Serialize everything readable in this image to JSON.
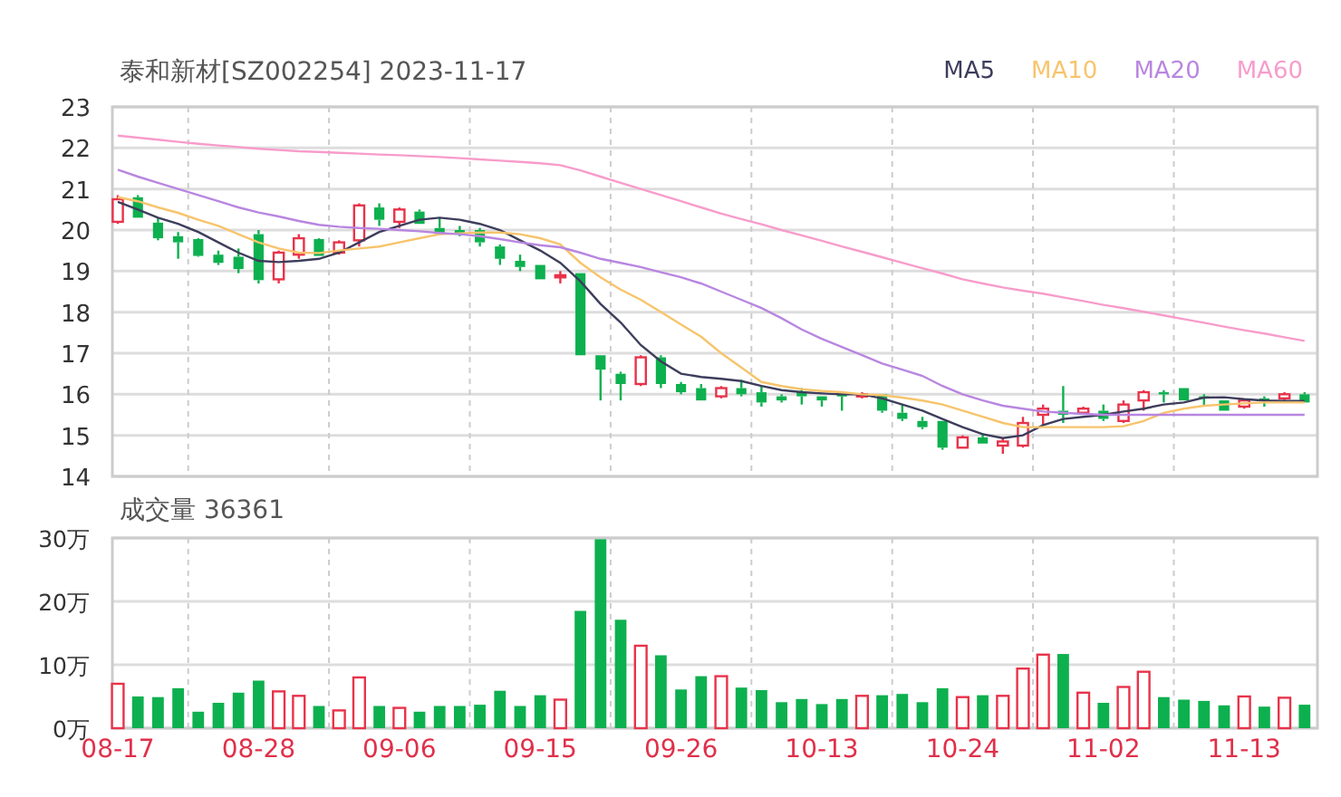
{
  "price_chart": {
    "title": "泰和新材[SZ002254] 2023-11-17",
    "chart_data": {
      "type": "line",
      "grid": true,
      "ylim": [
        14,
        23
      ],
      "yticks": [
        14,
        15,
        16,
        17,
        18,
        19,
        20,
        21,
        22,
        23
      ],
      "series": [
        {
          "name": "MA5",
          "color": "#3d3d5c",
          "values": [
            20.69,
            20.5,
            20.3,
            20.15,
            19.95,
            19.7,
            19.45,
            19.25,
            19.22,
            19.25,
            19.3,
            19.45,
            19.7,
            19.95,
            20.1,
            20.25,
            20.3,
            20.25,
            20.15,
            20.0,
            19.75,
            19.5,
            19.2,
            18.75,
            18.2,
            17.75,
            17.2,
            16.8,
            16.5,
            16.42,
            16.38,
            16.32,
            16.2,
            16.1,
            16.05,
            16.02,
            16.0,
            16.0,
            15.9,
            15.75,
            15.6,
            15.4,
            15.2,
            15.03,
            14.93,
            15.0,
            15.25,
            15.4,
            15.45,
            15.5,
            15.58,
            15.65,
            15.75,
            15.8,
            15.92,
            15.93,
            15.88,
            15.85,
            15.84,
            15.84
          ]
        },
        {
          "name": "MA10",
          "color": "#f7c46c",
          "values": [
            20.8,
            20.7,
            20.55,
            20.42,
            20.25,
            20.1,
            19.9,
            19.7,
            19.55,
            19.45,
            19.44,
            19.5,
            19.55,
            19.6,
            19.7,
            19.8,
            19.9,
            19.92,
            19.94,
            19.94,
            19.9,
            19.8,
            19.65,
            19.2,
            18.85,
            18.55,
            18.3,
            18.0,
            17.7,
            17.4,
            17.0,
            16.65,
            16.3,
            16.2,
            16.12,
            16.08,
            16.05,
            16.0,
            15.98,
            15.92,
            15.85,
            15.75,
            15.6,
            15.45,
            15.3,
            15.2,
            15.2,
            15.2,
            15.2,
            15.2,
            15.22,
            15.35,
            15.55,
            15.65,
            15.72,
            15.75,
            15.78,
            15.8,
            15.8,
            15.8
          ]
        },
        {
          "name": "MA20",
          "color": "#b886e0",
          "values": [
            21.47,
            21.3,
            21.15,
            21.0,
            20.85,
            20.7,
            20.55,
            20.43,
            20.33,
            20.22,
            20.13,
            20.08,
            20.05,
            20.03,
            20.0,
            19.97,
            19.93,
            19.9,
            19.85,
            19.78,
            19.7,
            19.63,
            19.58,
            19.45,
            19.3,
            19.2,
            19.1,
            18.97,
            18.85,
            18.7,
            18.5,
            18.3,
            18.1,
            17.85,
            17.58,
            17.35,
            17.15,
            16.95,
            16.75,
            16.6,
            16.45,
            16.2,
            16.0,
            15.85,
            15.72,
            15.65,
            15.58,
            15.55,
            15.52,
            15.5,
            15.5,
            15.5,
            15.5,
            15.5,
            15.5,
            15.5,
            15.5,
            15.5,
            15.5,
            15.5
          ]
        },
        {
          "name": "MA60",
          "color": "#f79ccb",
          "values": [
            22.3,
            22.25,
            22.2,
            22.15,
            22.1,
            22.06,
            22.02,
            21.98,
            21.95,
            21.92,
            21.9,
            21.88,
            21.86,
            21.84,
            21.82,
            21.8,
            21.78,
            21.75,
            21.72,
            21.69,
            21.66,
            21.63,
            21.58,
            21.45,
            21.3,
            21.15,
            21.0,
            20.85,
            20.7,
            20.55,
            20.4,
            20.27,
            20.14,
            20.0,
            19.87,
            19.74,
            19.6,
            19.47,
            19.34,
            19.2,
            19.07,
            18.94,
            18.8,
            18.7,
            18.6,
            18.52,
            18.45,
            18.36,
            18.27,
            18.18,
            18.1,
            18.01,
            17.92,
            17.83,
            17.74,
            17.65,
            17.56,
            17.48,
            17.39,
            17.3
          ]
        },
        {
          "type": "candlestick",
          "ohlc": [
            [
              20.2,
              20.85,
              20.15,
              20.75
            ],
            [
              20.8,
              20.85,
              20.3,
              20.3
            ],
            [
              20.18,
              20.3,
              19.75,
              19.8
            ],
            [
              19.85,
              19.95,
              19.3,
              19.7
            ],
            [
              19.78,
              19.8,
              19.35,
              19.37
            ],
            [
              19.4,
              19.5,
              19.15,
              19.2
            ],
            [
              19.35,
              19.55,
              18.95,
              19.05
            ],
            [
              19.9,
              20.0,
              18.7,
              18.78
            ],
            [
              18.8,
              19.5,
              18.7,
              19.45
            ],
            [
              19.4,
              19.9,
              19.3,
              19.8
            ],
            [
              19.78,
              19.8,
              19.37,
              19.37
            ],
            [
              19.45,
              19.75,
              19.4,
              19.7
            ],
            [
              19.75,
              20.65,
              19.6,
              20.6
            ],
            [
              20.55,
              20.65,
              20.1,
              20.25
            ],
            [
              20.2,
              20.55,
              20.05,
              20.5
            ],
            [
              20.45,
              20.5,
              20.15,
              20.15
            ],
            [
              20.05,
              20.3,
              19.9,
              19.9
            ],
            [
              20.0,
              20.1,
              19.85,
              19.9
            ],
            [
              20.0,
              20.05,
              19.6,
              19.7
            ],
            [
              19.6,
              19.65,
              19.15,
              19.3
            ],
            [
              19.25,
              19.4,
              19.0,
              19.1
            ],
            [
              19.15,
              19.15,
              18.8,
              18.8
            ],
            [
              18.85,
              19.0,
              18.7,
              18.9
            ],
            [
              18.95,
              18.95,
              16.95,
              16.95
            ],
            [
              16.95,
              16.95,
              15.85,
              16.6
            ],
            [
              16.5,
              16.55,
              15.85,
              16.25
            ],
            [
              16.25,
              16.95,
              16.2,
              16.9
            ],
            [
              16.9,
              16.95,
              16.15,
              16.25
            ],
            [
              16.25,
              16.3,
              16.0,
              16.05
            ],
            [
              16.15,
              16.25,
              15.85,
              15.85
            ],
            [
              15.95,
              16.2,
              15.9,
              16.15
            ],
            [
              16.15,
              16.35,
              15.95,
              16.0
            ],
            [
              16.05,
              16.2,
              15.7,
              15.8
            ],
            [
              15.95,
              16.0,
              15.8,
              15.85
            ],
            [
              16.05,
              16.15,
              15.75,
              15.95
            ],
            [
              15.95,
              15.95,
              15.7,
              15.85
            ],
            [
              16.0,
              16.0,
              15.6,
              15.95
            ],
            [
              15.95,
              16.05,
              15.9,
              16.0
            ],
            [
              16.0,
              16.0,
              15.55,
              15.6
            ],
            [
              15.55,
              15.75,
              15.35,
              15.4
            ],
            [
              15.35,
              15.45,
              15.15,
              15.2
            ],
            [
              15.35,
              15.35,
              14.65,
              14.7
            ],
            [
              14.7,
              15.0,
              14.7,
              14.95
            ],
            [
              14.95,
              15.05,
              14.8,
              14.8
            ],
            [
              14.75,
              14.95,
              14.55,
              14.85
            ],
            [
              14.75,
              15.45,
              14.7,
              15.3
            ],
            [
              15.5,
              15.75,
              15.25,
              15.65
            ],
            [
              15.6,
              16.2,
              15.3,
              15.5
            ],
            [
              15.55,
              15.7,
              15.5,
              15.65
            ],
            [
              15.6,
              15.75,
              15.35,
              15.4
            ],
            [
              15.35,
              15.85,
              15.3,
              15.75
            ],
            [
              15.85,
              16.1,
              15.6,
              16.05
            ],
            [
              16.05,
              16.1,
              15.8,
              16.0
            ],
            [
              16.15,
              16.15,
              15.85,
              15.85
            ],
            [
              15.95,
              16.0,
              15.7,
              15.9
            ],
            [
              15.85,
              15.85,
              15.6,
              15.6
            ],
            [
              15.7,
              15.9,
              15.65,
              15.85
            ],
            [
              15.9,
              15.95,
              15.7,
              15.85
            ],
            [
              15.9,
              16.05,
              15.85,
              16.0
            ],
            [
              16.0,
              16.05,
              15.8,
              15.8
            ]
          ]
        }
      ]
    }
  },
  "volume_chart": {
    "title": "成交量 36361",
    "chart_data": {
      "type": "bar",
      "grid": true,
      "ylim": [
        0,
        30
      ],
      "yticks": [
        {
          "value": 0,
          "label": "0万"
        },
        {
          "value": 10,
          "label": "10万"
        },
        {
          "value": 20,
          "label": "20万"
        },
        {
          "value": 30,
          "label": "30万"
        }
      ],
      "categories": [
        "08-17",
        null,
        null,
        null,
        null,
        null,
        null,
        "08-28",
        null,
        null,
        null,
        null,
        null,
        null,
        "09-06",
        null,
        null,
        null,
        null,
        null,
        null,
        "09-15",
        null,
        null,
        null,
        null,
        null,
        null,
        "09-26",
        null,
        null,
        null,
        null,
        null,
        null,
        "10-13",
        null,
        null,
        null,
        null,
        null,
        null,
        "10-24",
        null,
        null,
        null,
        null,
        null,
        null,
        "11-02",
        null,
        null,
        null,
        null,
        null,
        null,
        "11-13",
        null,
        null,
        null
      ],
      "values": [
        7.0,
        5.0,
        4.9,
        6.3,
        2.6,
        4.0,
        5.6,
        7.5,
        5.8,
        5.1,
        3.5,
        2.8,
        8.0,
        3.5,
        3.2,
        2.6,
        3.5,
        3.5,
        3.7,
        5.9,
        3.5,
        5.2,
        4.5,
        18.5,
        29.8,
        17.1,
        13.0,
        11.5,
        6.1,
        8.2,
        8.2,
        6.4,
        6.0,
        4.1,
        4.6,
        3.8,
        4.6,
        5.1,
        5.2,
        5.4,
        4.1,
        6.3,
        4.9,
        5.2,
        5.1,
        9.4,
        11.6,
        11.7,
        5.6,
        4.0,
        6.5,
        8.9,
        4.9,
        4.5,
        4.3,
        3.6,
        5.0,
        3.4,
        4.8,
        3.7
      ]
    }
  }
}
